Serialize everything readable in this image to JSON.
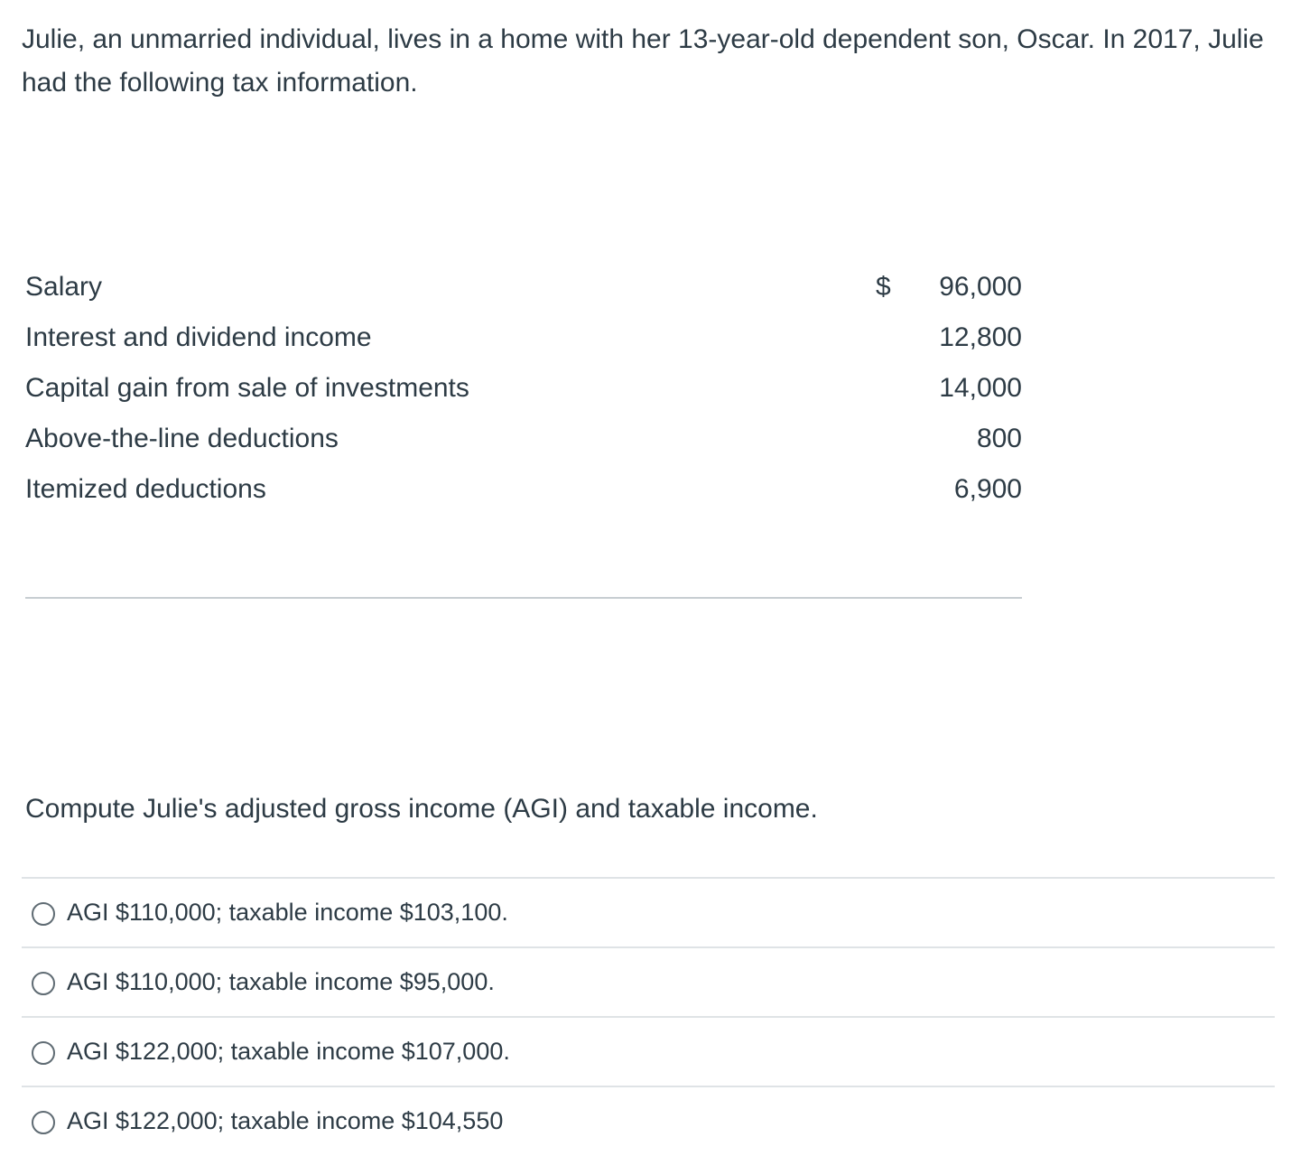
{
  "intro": "Julie, an unmarried individual, lives in a home with her 13-year-old dependent son, Oscar. In 2017, Julie had the following tax information.",
  "table": {
    "currency_symbol": "$",
    "rows": [
      {
        "label": "Salary",
        "amount": "96,000"
      },
      {
        "label": "Interest and dividend income",
        "amount": "12,800"
      },
      {
        "label": "Capital gain from sale of investments",
        "amount": "14,000"
      },
      {
        "label": "Above-the-line deductions",
        "amount": "800"
      },
      {
        "label": "Itemized deductions",
        "amount": "6,900"
      }
    ]
  },
  "question": "Compute Julie's adjusted gross income (AGI) and taxable income.",
  "answers": [
    {
      "text": "AGI $110,000; taxable income $103,100."
    },
    {
      "text": "AGI $110,000; taxable income $95,000."
    },
    {
      "text": "AGI $122,000; taxable income $107,000."
    },
    {
      "text": "AGI $122,000; taxable income $104,550"
    }
  ]
}
